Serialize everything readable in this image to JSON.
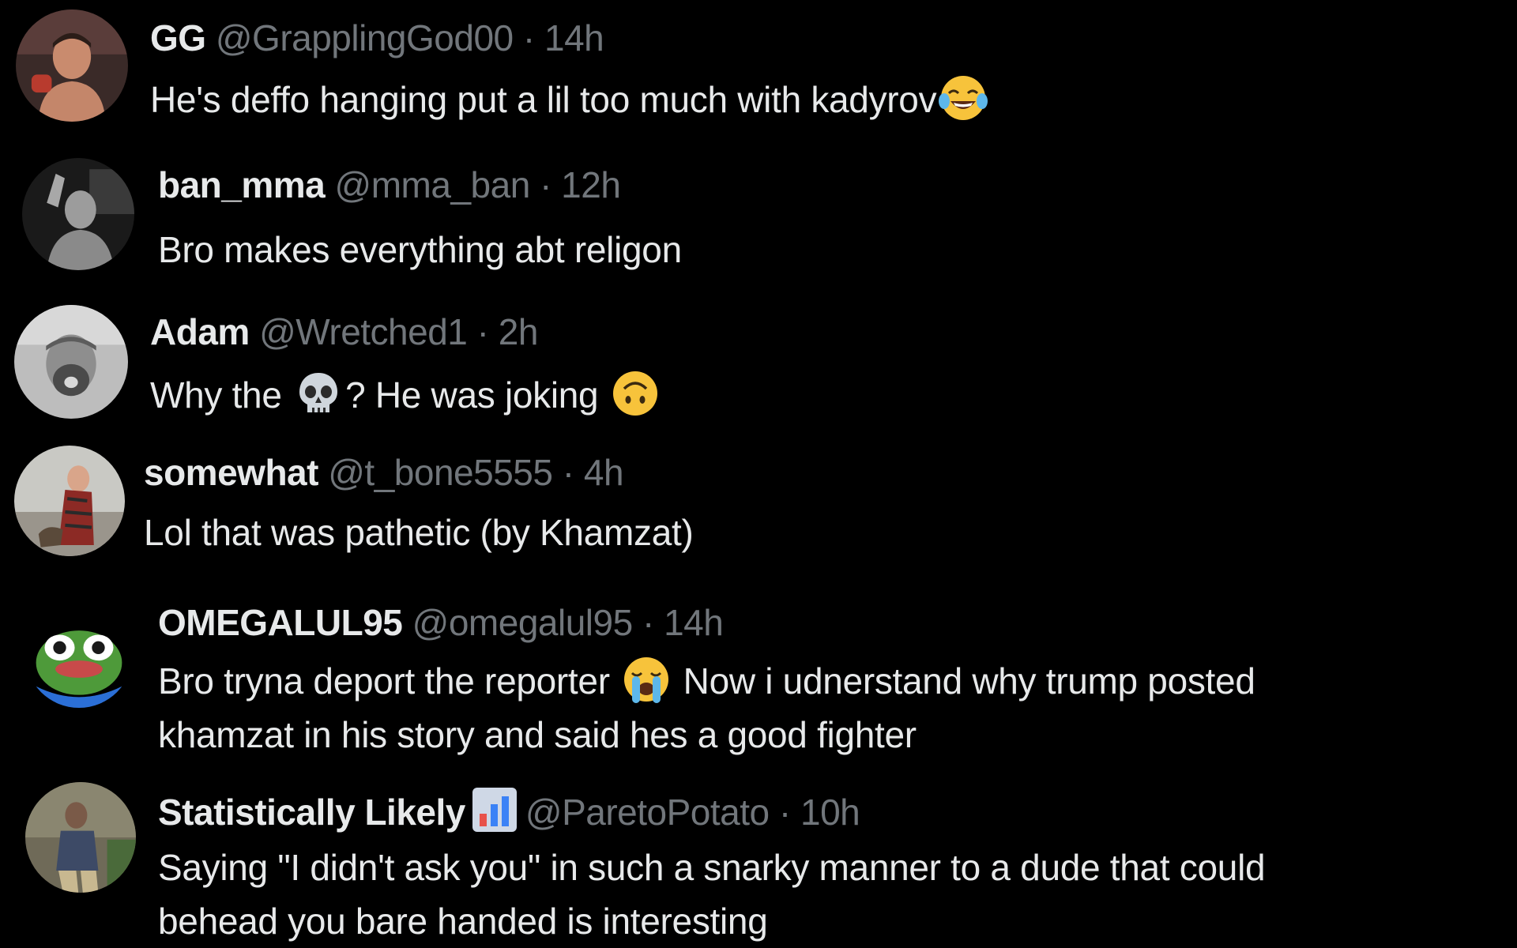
{
  "replies": [
    {
      "name": "GG",
      "handle": "@GrapplingGod00",
      "separator": "·",
      "time": "14h",
      "text_1": "He's deffo hanging put a lil too much with kadyrov",
      "emoji_1": "face-with-tears-of-joy-icon"
    },
    {
      "name": "ban_mma",
      "handle": "@mma_ban",
      "separator": "·",
      "time": "12h",
      "text_1": "Bro makes everything abt religon"
    },
    {
      "name": "Adam",
      "handle": "@Wretched1",
      "separator": "·",
      "time": "2h",
      "text_1": "Why the ",
      "emoji_1": "skull-icon",
      "text_2": "? He was joking ",
      "emoji_2": "upside-down-face-icon"
    },
    {
      "name": "somewhat",
      "handle": "@t_bone5555",
      "separator": "·",
      "time": "4h",
      "text_1": "Lol that was pathetic (by Khamzat)"
    },
    {
      "name": "OMEGALUL95",
      "handle": "@omegalul95",
      "separator": "·",
      "time": "14h",
      "text_1": "Bro tryna deport the reporter ",
      "emoji_1": "loudly-crying-face-icon",
      "text_2": " Now i udnerstand why trump posted",
      "line_2": "khamzat in his story and said hes a good fighter"
    },
    {
      "name": "Statistically Likely",
      "name_badge": "bar-chart-icon",
      "handle": "@ParetoPotato",
      "separator": "·",
      "time": "10h",
      "line_1": "Saying \"I didn't ask you\" in such a snarky manner to a dude that could",
      "line_2": "behead you bare handed  is interesting"
    }
  ],
  "colors": {
    "background": "#000000",
    "primary_text": "#e7e9ea",
    "secondary_text": "#71767b"
  }
}
